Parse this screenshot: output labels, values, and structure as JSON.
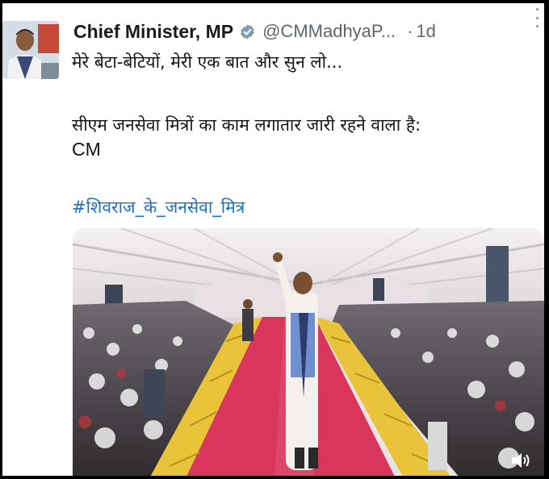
{
  "post": {
    "author_name": "Chief Minister, MP",
    "handle": "@CMMadhyaP...",
    "separator": "·",
    "time": "1d",
    "text_line1": "मेरे बेटा-बेटियों, मेरी एक बात और सुन लो...",
    "text_line2": "सीएम जनसेवा मित्रों का काम लगातार जारी रहने वाला है:",
    "text_line3": "CM",
    "hashtag": "#शिवराज_के_जनसेवा_मित्र"
  },
  "icons": {
    "verified": "verified-badge-icon",
    "more": "more-vertical-icon",
    "sound": "speaker-volume-icon"
  },
  "colors": {
    "hashtag": "#1d6fc2",
    "handle": "#5b6670",
    "carpet": "#d8365a",
    "railing": "#e9c43a"
  }
}
